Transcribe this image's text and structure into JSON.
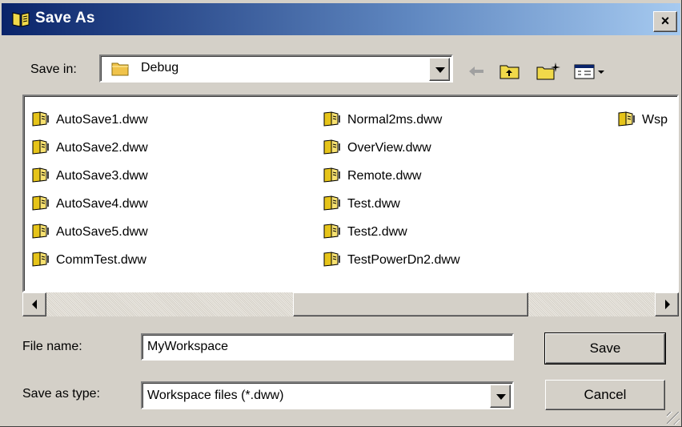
{
  "window": {
    "title": "Save As",
    "close_glyph": "×",
    "icon": "open-book-icon"
  },
  "toolbar": {
    "save_in_label": "Save in:",
    "save_in_value": "Debug",
    "folder_icon": "folder-icon",
    "back_icon": "back-arrow-icon",
    "up_icon": "up-folder-icon",
    "new_folder_icon": "new-folder-icon",
    "view_menu_icon": "view-menu-icon"
  },
  "files": {
    "columns": [
      [
        "AutoSave1.dww",
        "AutoSave2.dww",
        "AutoSave3.dww",
        "AutoSave4.dww",
        "AutoSave5.dww",
        "CommTest.dww"
      ],
      [
        "Normal2ms.dww",
        "OverView.dww",
        "Remote.dww",
        "Test.dww",
        "Test2.dww",
        "TestPowerDn2.dww"
      ],
      [
        "Wsp"
      ]
    ],
    "icon": "workspace-file-icon"
  },
  "form": {
    "file_name_label": "File name:",
    "file_name_value": "MyWorkspace",
    "save_type_label": "Save as type:",
    "save_type_value": "Workspace files (*.dww)"
  },
  "buttons": {
    "save": "Save",
    "cancel": "Cancel"
  },
  "colors": {
    "title_bar": "#0a246a",
    "face": "#d4d0c8",
    "folder": "#f0c34a",
    "file_icon": "#e6c419"
  }
}
